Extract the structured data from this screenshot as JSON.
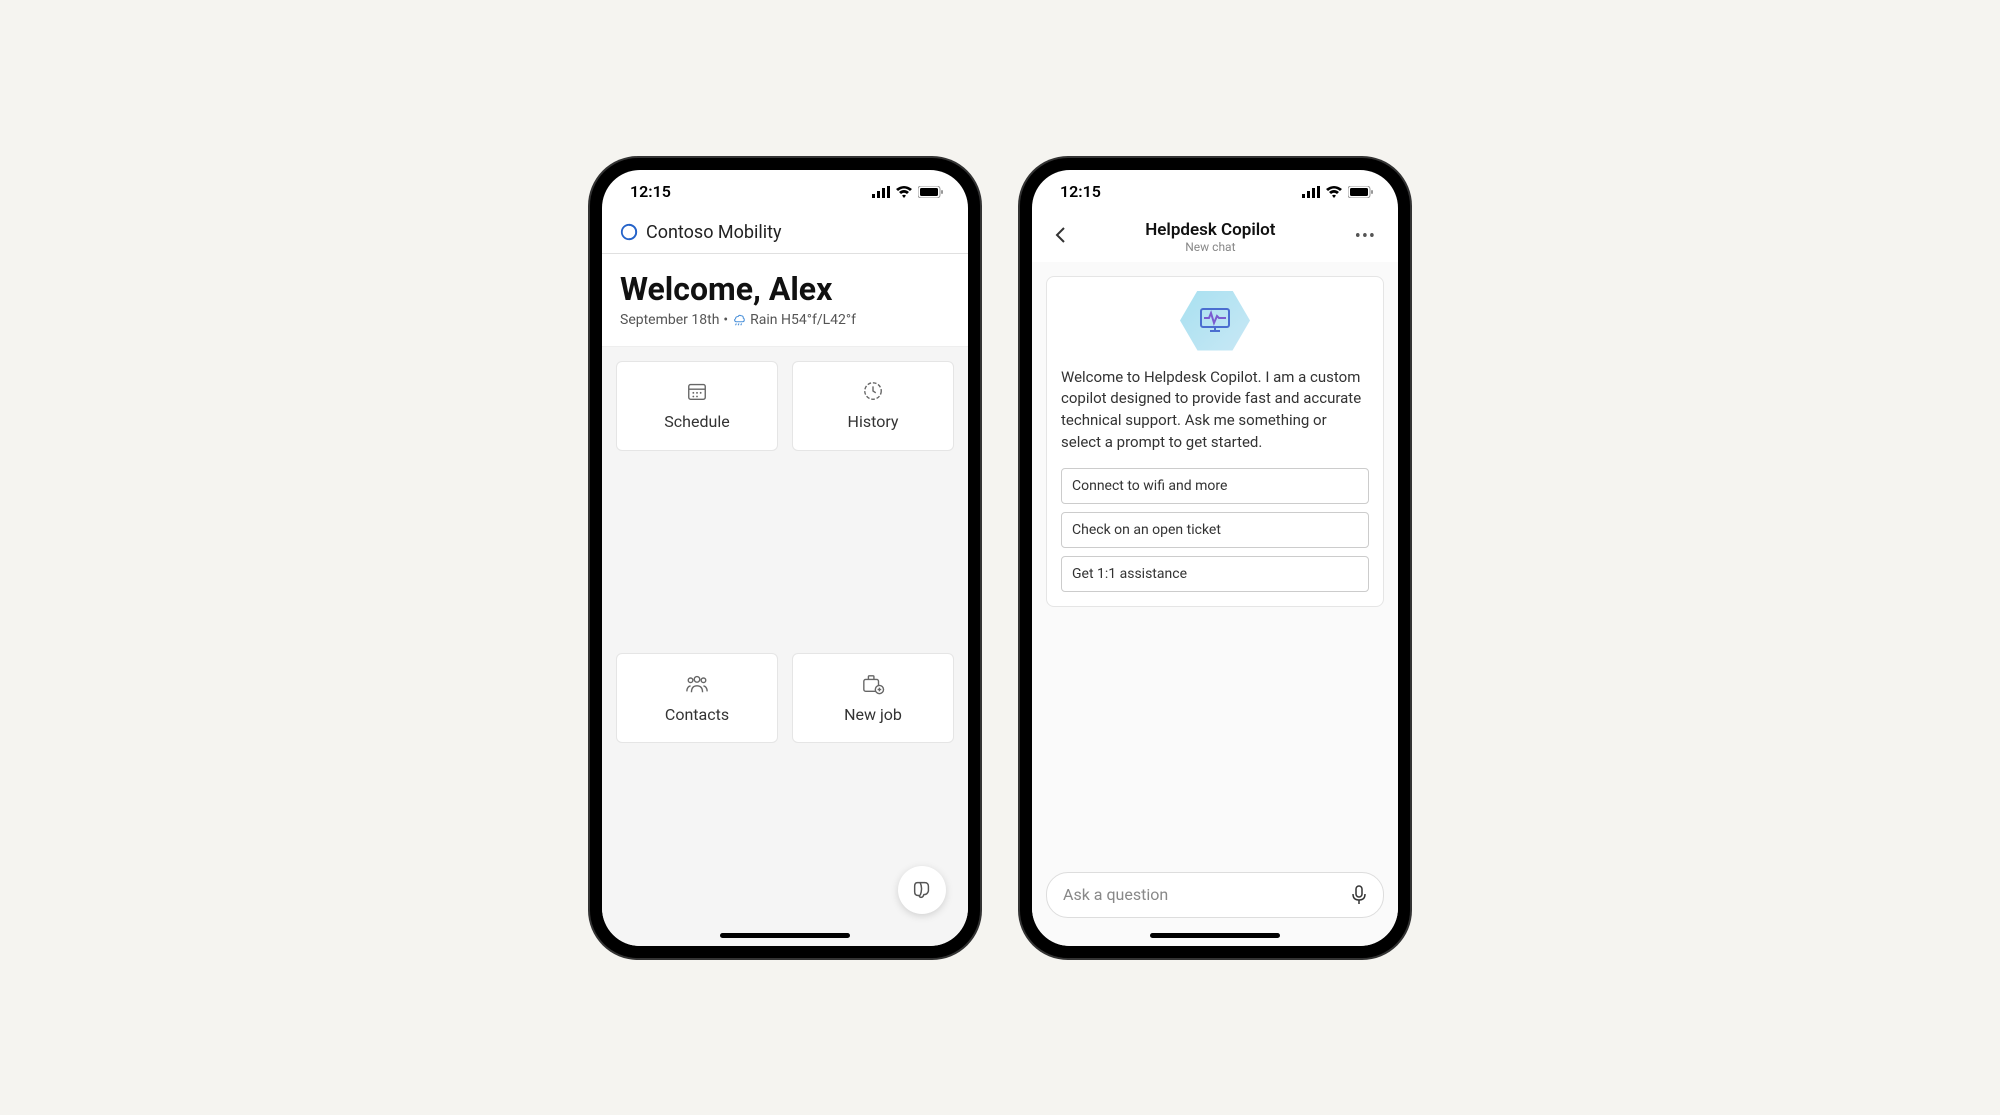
{
  "status": {
    "time": "12:15"
  },
  "home": {
    "app_title": "Contoso Mobility",
    "welcome_title": "Welcome, Alex",
    "date": "September 18th",
    "weather": "Rain H54°f/L42°f",
    "tiles": {
      "schedule": "Schedule",
      "history": "History",
      "contacts": "Contacts",
      "newjob": "New job"
    }
  },
  "copilot": {
    "title": "Helpdesk Copilot",
    "subtitle": "New chat",
    "intro": "Welcome to Helpdesk Copilot. I am a custom copilot designed to provide fast and accurate technical support. Ask me something or select a prompt to get started.",
    "prompts": {
      "p1": "Connect to wifi and more",
      "p2": "Check on an open ticket",
      "p3": "Get 1:1 assistance"
    },
    "input_placeholder": "Ask a question"
  }
}
